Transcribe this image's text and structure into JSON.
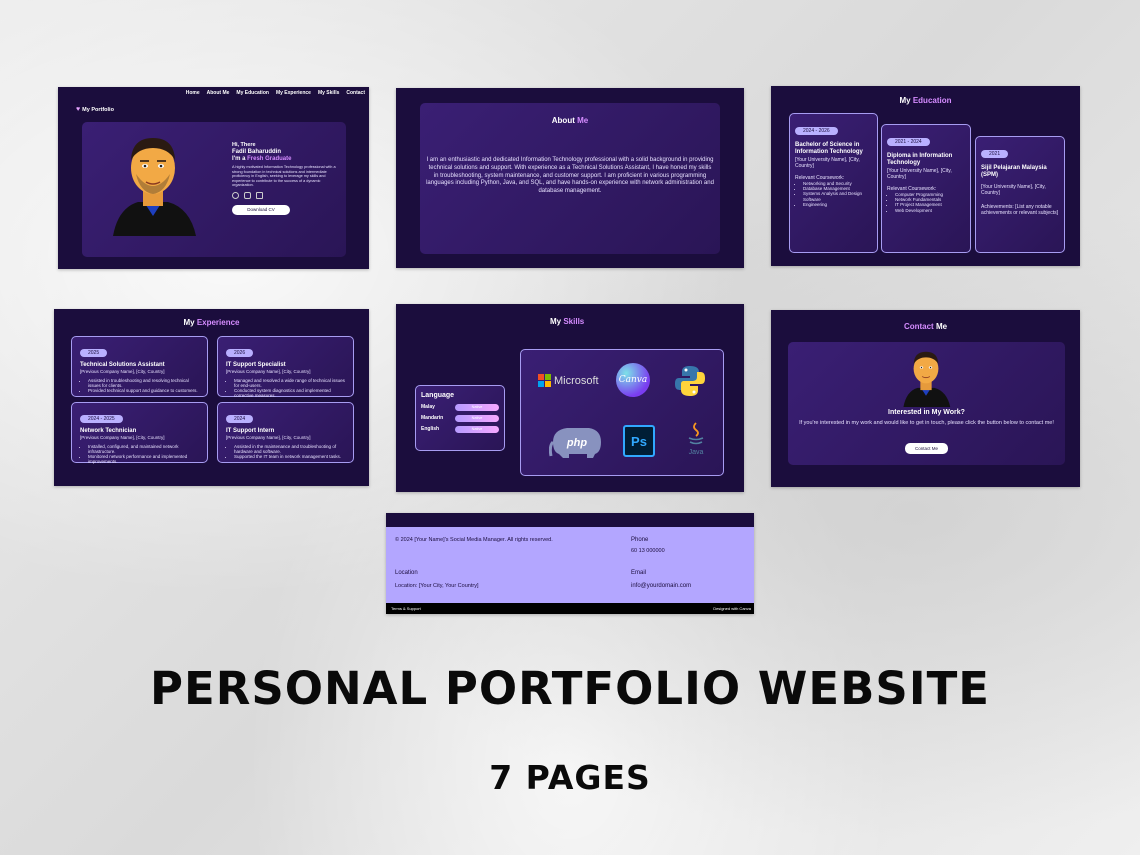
{
  "hero": {
    "logo": "My Portfolio",
    "nav": [
      "Home",
      "About Me",
      "My Education",
      "My Experience",
      "My Skills",
      "Contact"
    ],
    "greeting": "Hi, There",
    "name": "Fadil Baharuddin",
    "tagline_prefix": "I'm a ",
    "tagline_highlight": "Fresh Graduate",
    "intro": "A highly motivated Information Technology professional with a strong foundation in technical solutions and intermediate proficiency in English, seeking to leverage my skills and experience to contribute to the success of a dynamic organization.",
    "cta": "Download CV"
  },
  "about": {
    "title_a": "About ",
    "title_b": "Me",
    "text": "I am an enthusiastic and dedicated Information Technology professional with a solid background in providing technical solutions and support. With experience as a Technical Solutions Assistant, I have honed my skills in troubleshooting, system maintenance, and customer support. I am proficient in various programming languages including Python, Java, and SQL, and have hands-on experience with network administration and database management."
  },
  "education": {
    "title_a": "My ",
    "title_b": "Education",
    "items": [
      {
        "years": "2024 - 2026",
        "degree": "Bachelor of Science in Information Technology",
        "place": "[Your University Name], [City, Country]",
        "label": "Relevant Coursework:",
        "list": [
          "Networking and Security",
          "Database Management",
          "Systems Analysis and Design Software",
          "Engineering"
        ]
      },
      {
        "years": "2021 - 2024",
        "degree": "Diploma in Information Technology",
        "place": "[Your University Name], [City, Country]",
        "label": "Relevant Coursework:",
        "list": [
          "Computer Programming",
          "Network Fundamentals",
          "IT Project Management",
          "Web Development"
        ]
      },
      {
        "years": "2021",
        "degree": "Sijil Pelajaran Malaysia (SPM)",
        "place": "[Your University Name], [City, Country]",
        "label": "Achievements: [List any notable achievements or relevant subjects]",
        "list": []
      }
    ]
  },
  "experience": {
    "title_a": "My ",
    "title_b": "Experience",
    "items": [
      {
        "years": "2025",
        "role": "Technical Solutions Assistant",
        "company": "[Previous Company Name], [City, Country]",
        "list": [
          "Assisted in troubleshooting and resolving technical issues for clients.",
          "Provided technical support and guidance to customers."
        ]
      },
      {
        "years": "2026",
        "role": "IT Support Specialist",
        "company": "[Previous Company Name], [City, Country]",
        "list": [
          "Managed and resolved a wide range of technical issues for end-users.",
          "Conducted system diagnostics and implemented corrective measures."
        ]
      },
      {
        "years": "2024 - 2025",
        "role": "Network Technician",
        "company": "[Previous Company Name], [City, Country]",
        "list": [
          "Installed, configured, and maintained network infrastructure.",
          "Monitored network performance and implemented improvements."
        ]
      },
      {
        "years": "2024",
        "role": "IT Support Intern",
        "company": "[Previous Company Name], [City, Country]",
        "list": [
          "Assisted in the maintenance and troubleshooting of hardware and software.",
          "Supported the IT team in network management tasks."
        ]
      }
    ]
  },
  "skills": {
    "title_a": "My ",
    "title_b": "Skills",
    "language_title": "Language",
    "languages": [
      {
        "name": "Malay",
        "level": "Native"
      },
      {
        "name": "Mandarin",
        "level": "Native"
      },
      {
        "name": "English",
        "level": "Native"
      }
    ],
    "tools": [
      "Microsoft",
      "Canva",
      "python",
      "php",
      "Ps",
      "Java"
    ]
  },
  "contact": {
    "title_a": "Contact ",
    "title_b": "Me",
    "heading": "Interested in My Work?",
    "text": "If you're interested in my work and would like to get in touch, please click the button below to contact me!",
    "cta": "Contact Me"
  },
  "footer": {
    "copyright": "© 2024 [Your Name]'s Social Media Manager. All rights reserved.",
    "phone_label": "Phone",
    "phone": "60 13 000000",
    "location_label": "Location",
    "location": "Location: [Your City, Your Country]",
    "email_label": "Email",
    "email": "info@yourdomain.com",
    "terms": "Terms & Support",
    "designed": "Designed with Canva"
  },
  "headline": "PERSONAL PORTFOLIO WEBSITE",
  "subheadline": "7 PAGES",
  "colors": {
    "panel_bg": "#1b0d3d",
    "accent": "#d58cff",
    "pill": "#b9b0ff",
    "footer_bg": "#b3a6ff"
  }
}
